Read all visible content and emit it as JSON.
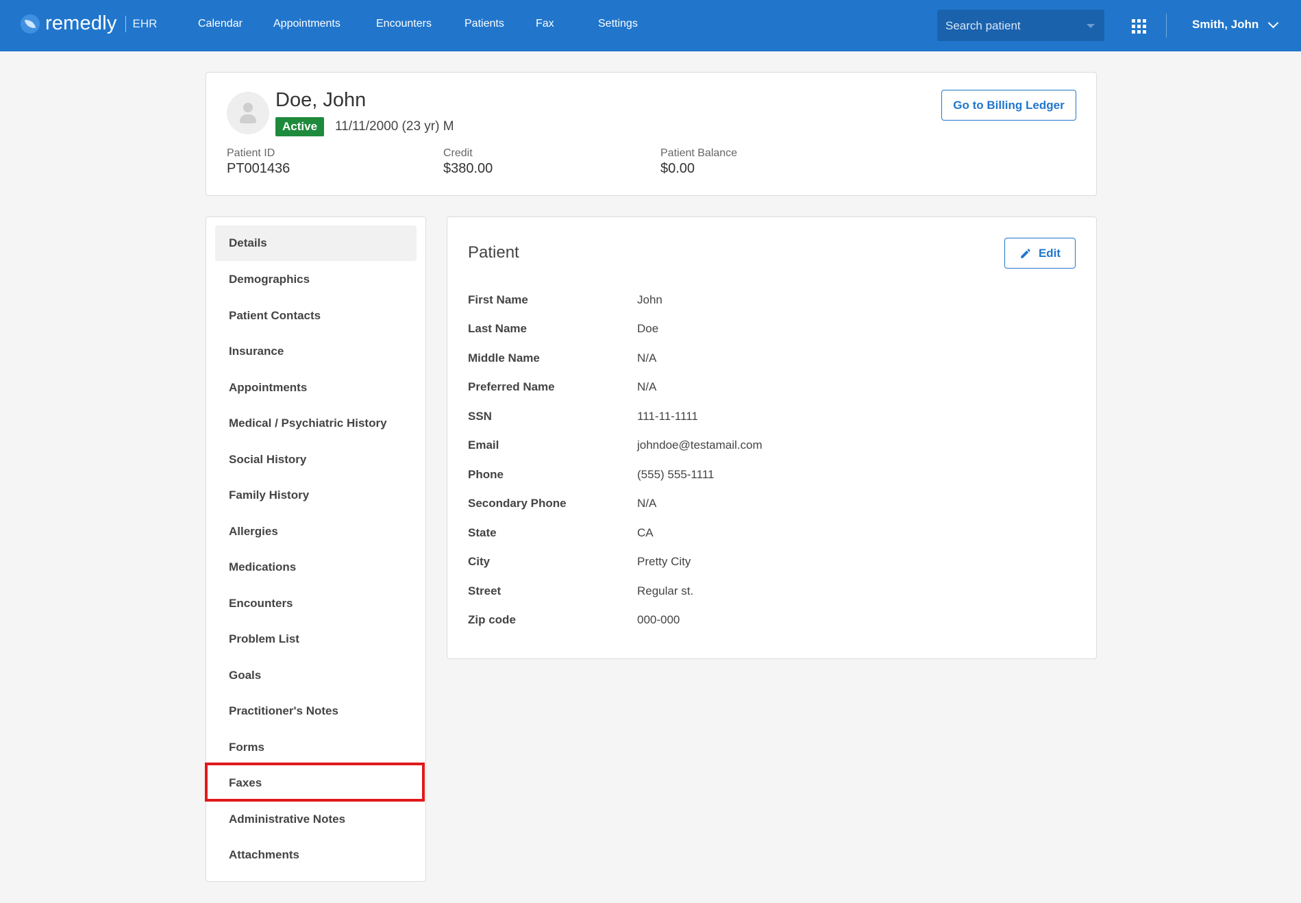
{
  "brand": {
    "name": "remedly",
    "product": "EHR"
  },
  "nav": [
    "Calendar",
    "Appointments",
    "Encounters",
    "Patients",
    "Fax",
    "Settings"
  ],
  "search": {
    "placeholder": "Search patient"
  },
  "user": {
    "name": "Smith, John"
  },
  "patient": {
    "name": "Doe, John",
    "status": "Active",
    "dob": "11/11/2000 (23 yr) M",
    "stats": [
      {
        "label": "Patient ID",
        "value": "PT001436"
      },
      {
        "label": "Credit",
        "value": "$380.00"
      },
      {
        "label": "Patient Balance",
        "value": "$0.00"
      }
    ],
    "billing_button": "Go to Billing Ledger"
  },
  "sidebar": {
    "items": [
      "Details",
      "Demographics",
      "Patient Contacts",
      "Insurance",
      "Appointments",
      "Medical / Psychiatric History",
      "Social History",
      "Family History",
      "Allergies",
      "Medications",
      "Encounters",
      "Problem List",
      "Goals",
      "Practitioner's Notes",
      "Forms",
      "Faxes",
      "Administrative Notes",
      "Attachments"
    ],
    "active": "Details",
    "highlighted": "Faxes"
  },
  "details": {
    "title": "Patient",
    "edit_label": "Edit",
    "fields": [
      {
        "label": "First Name",
        "value": "John"
      },
      {
        "label": "Last Name",
        "value": "Doe"
      },
      {
        "label": "Middle Name",
        "value": "N/A"
      },
      {
        "label": "Preferred Name",
        "value": "N/A"
      },
      {
        "label": "SSN",
        "value": "111-11-1111"
      },
      {
        "label": "Email",
        "value": "johndoe@testamail.com"
      },
      {
        "label": "Phone",
        "value": "(555) 555-1111"
      },
      {
        "label": "Secondary Phone",
        "value": "N/A"
      },
      {
        "label": "State",
        "value": "CA"
      },
      {
        "label": "City",
        "value": "Pretty City"
      },
      {
        "label": "Street",
        "value": "Regular st."
      },
      {
        "label": "Zip code",
        "value": "000-000"
      }
    ]
  },
  "colors": {
    "primary": "#2176cc",
    "active_badge": "#1e8a3c",
    "highlight": "#e0191b"
  }
}
